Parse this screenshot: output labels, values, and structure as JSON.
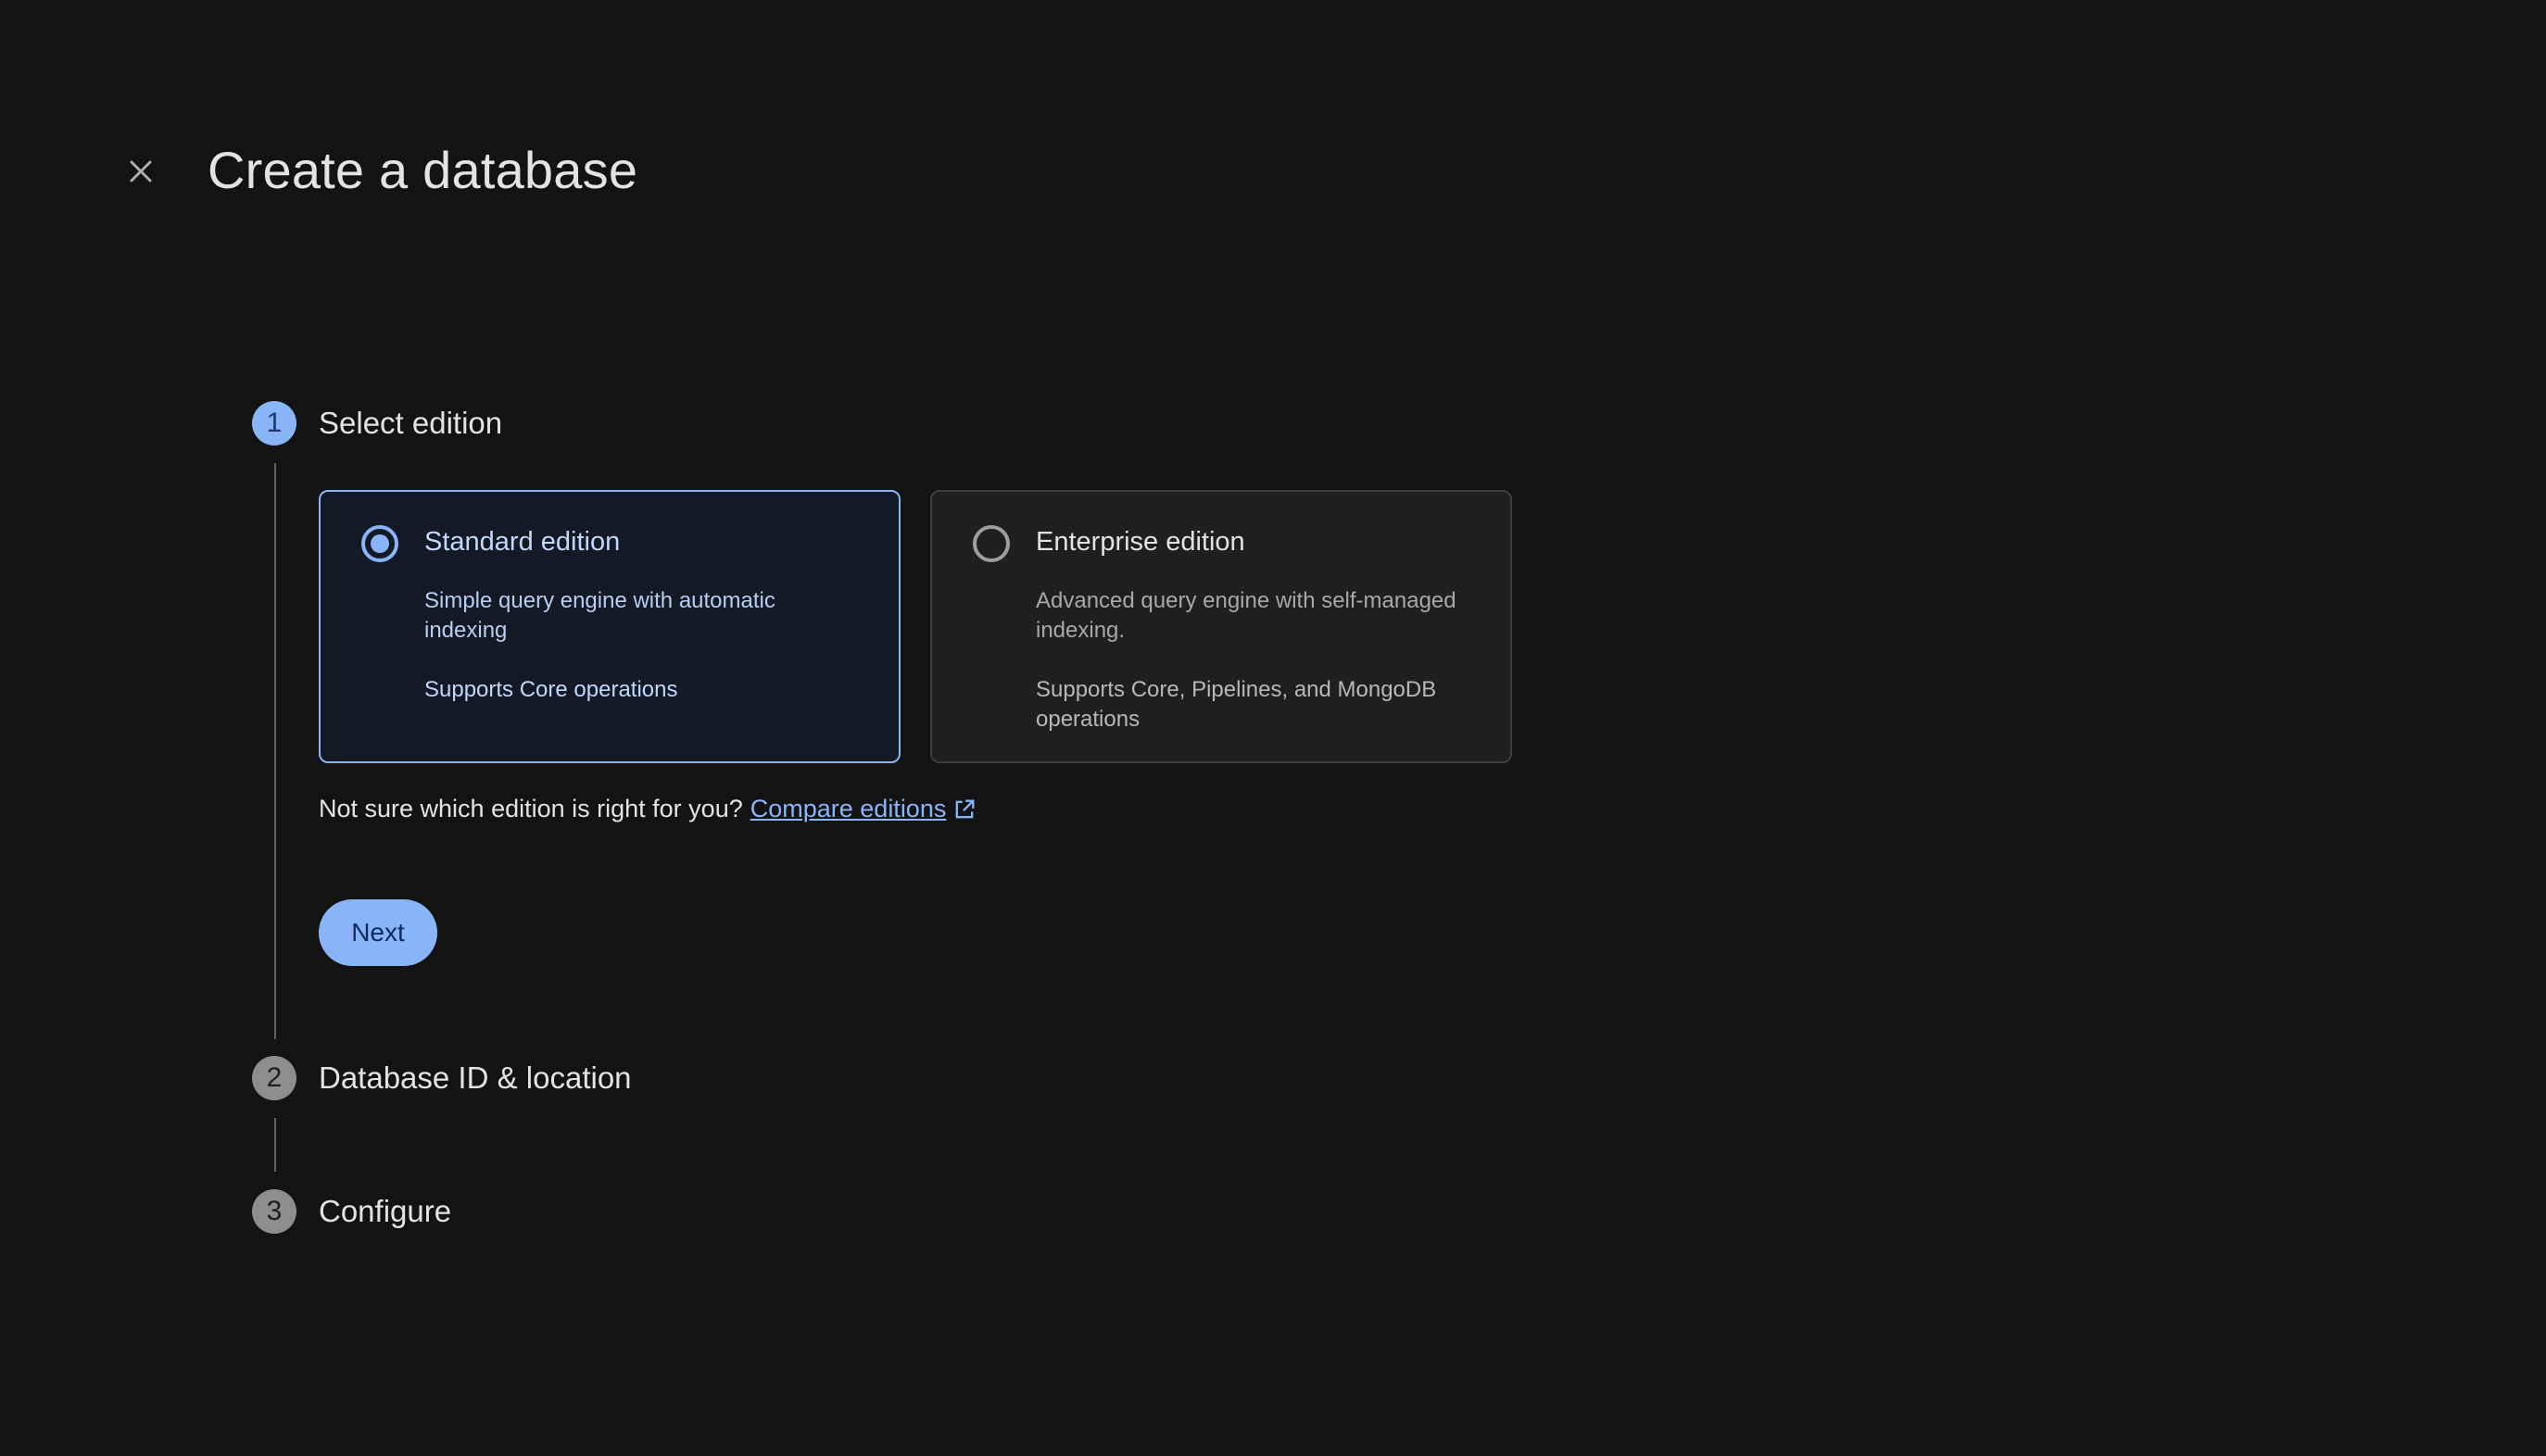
{
  "header": {
    "title": "Create a database",
    "close_icon": "close-icon"
  },
  "steps": [
    {
      "number": "1",
      "label": "Select edition",
      "state": "active"
    },
    {
      "number": "2",
      "label": "Database ID & location",
      "state": "inactive"
    },
    {
      "number": "3",
      "label": "Configure",
      "state": "inactive"
    }
  ],
  "editions": [
    {
      "title": "Standard edition",
      "description": "Simple query engine with automatic indexing",
      "support": "Supports Core operations",
      "selected": true
    },
    {
      "title": "Enterprise edition",
      "description": "Advanced query engine with self-managed indexing.",
      "support": "Supports Core, Pipelines, and MongoDB operations",
      "selected": false
    }
  ],
  "compare": {
    "prompt": "Not sure which edition is right for you?",
    "link_label": "Compare editions",
    "link_icon": "open-in-new-icon"
  },
  "actions": {
    "next_label": "Next"
  },
  "colors": {
    "background": "#131313",
    "accent": "#8ab4f8",
    "inactive_step": "#8e8e8e"
  }
}
